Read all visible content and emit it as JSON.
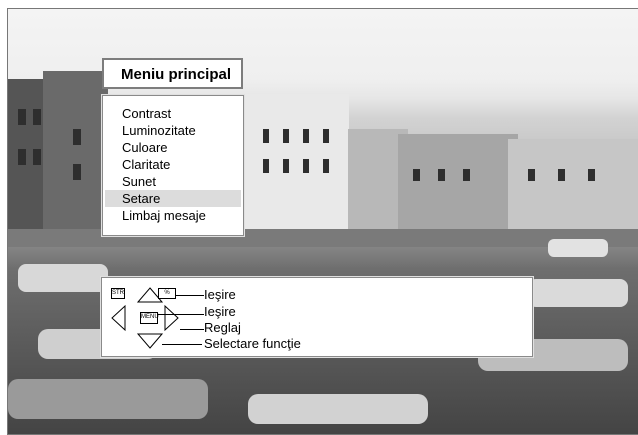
{
  "menu": {
    "title": "Meniu principal",
    "items": [
      {
        "label": "Contrast",
        "selected": false
      },
      {
        "label": "Luminozitate",
        "selected": false
      },
      {
        "label": "Culoare",
        "selected": false
      },
      {
        "label": "Claritate",
        "selected": false
      },
      {
        "label": "Sunet",
        "selected": false
      },
      {
        "label": "Setare",
        "selected": true
      },
      {
        "label": "Limbaj mesaje",
        "selected": false
      }
    ]
  },
  "help": {
    "keys": {
      "str": "STR",
      "ks": "%",
      "menu": "MENU"
    },
    "lines": [
      "Ieşire",
      "Ieşire",
      "Reglaj",
      "Selectare funcţie"
    ]
  },
  "colors": {
    "selected_bg": "#dcdcdc",
    "border": "#7d7d7d"
  }
}
